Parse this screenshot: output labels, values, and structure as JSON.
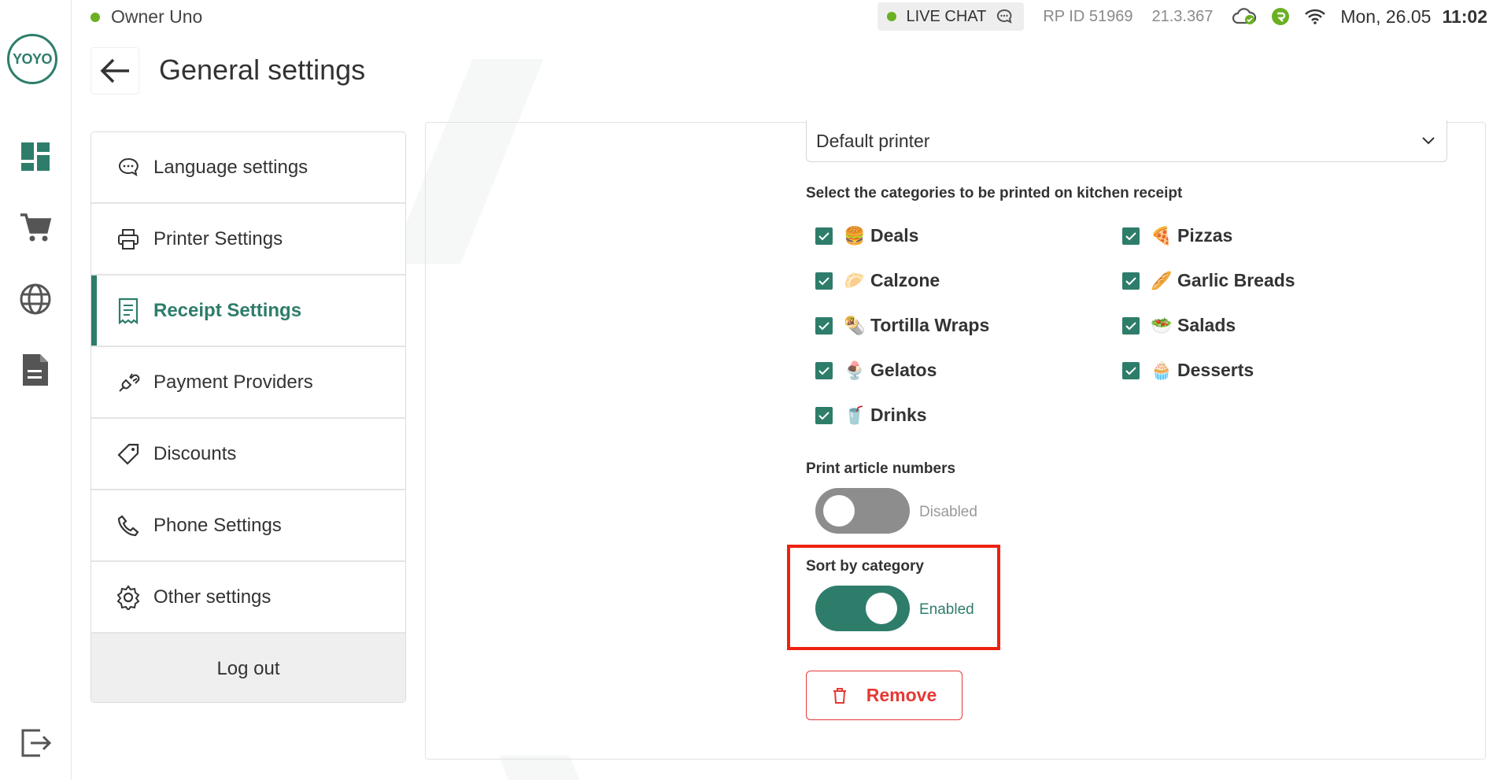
{
  "app": {
    "logo_text": "YOYO"
  },
  "topbar": {
    "owner_name": "Owner Uno",
    "live_chat_label": "LIVE CHAT",
    "rp_id": "RP ID 51969",
    "version": "21.3.367",
    "date": "Mon, 26.05",
    "time": "11:02"
  },
  "header": {
    "title": "General settings"
  },
  "rail": {
    "icons": [
      "dashboard-icon",
      "cart-icon",
      "globe-icon",
      "document-icon",
      "exit-icon"
    ]
  },
  "sidebar": {
    "items": [
      {
        "label": "Language settings",
        "icon": "chat-bubbles-icon",
        "active": false
      },
      {
        "label": "Printer Settings",
        "icon": "printer-icon",
        "active": false
      },
      {
        "label": "Receipt Settings",
        "icon": "receipt-icon",
        "active": true
      },
      {
        "label": "Payment Providers",
        "icon": "plug-icon",
        "active": false
      },
      {
        "label": "Discounts",
        "icon": "tag-icon",
        "active": false
      },
      {
        "label": "Phone Settings",
        "icon": "phone-icon",
        "active": false
      },
      {
        "label": "Other settings",
        "icon": "gear-icon",
        "active": false
      }
    ],
    "logout_label": "Log out"
  },
  "receipt": {
    "printer_select_value": "Default printer",
    "categories_label": "Select the categories to be printed on kitchen receipt",
    "categories": [
      {
        "label": "Deals",
        "emoji": "🍔",
        "checked": true
      },
      {
        "label": "Pizzas",
        "emoji": "🍕",
        "checked": true
      },
      {
        "label": "Calzone",
        "emoji": "🥟",
        "checked": true
      },
      {
        "label": "Garlic Breads",
        "emoji": "🥖",
        "checked": true
      },
      {
        "label": "Tortilla Wraps",
        "emoji": "🌯",
        "checked": true
      },
      {
        "label": "Salads",
        "emoji": "🥗",
        "checked": true
      },
      {
        "label": "Gelatos",
        "emoji": "🍨",
        "checked": true
      },
      {
        "label": "Desserts",
        "emoji": "🧁",
        "checked": true
      },
      {
        "label": "Drinks",
        "emoji": "🥤",
        "checked": true
      }
    ],
    "print_article_numbers": {
      "label": "Print article numbers",
      "state": "Disabled",
      "on": false
    },
    "sort_by_category": {
      "label": "Sort by category",
      "state": "Enabled",
      "on": true
    },
    "remove_label": "Remove"
  },
  "colors": {
    "accent": "#2e7d6b",
    "danger": "#e53935",
    "highlight": "#ee2211",
    "status_green": "#6ab023"
  }
}
